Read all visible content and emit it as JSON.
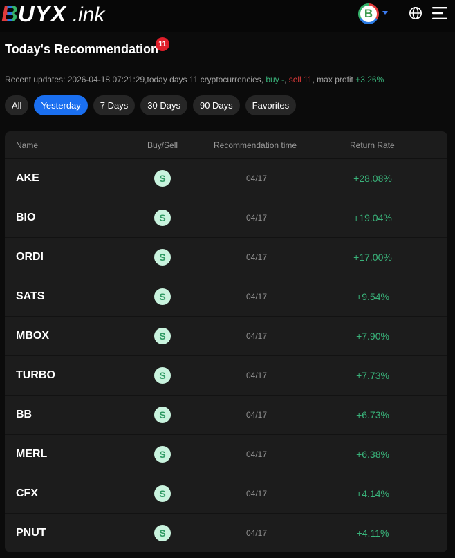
{
  "header": {
    "logo_first_letter": "B",
    "logo_rest": "UYX",
    "logo_tld": ".ink",
    "avatar_letter": "B"
  },
  "page": {
    "title": "Today's Recommendation",
    "badge_count": "11"
  },
  "updates": {
    "prefix": "Recent updates: 2026-04-18 07:21:29,today days 11 cryptocurrencies, ",
    "buy": "buy -",
    "sep1": ", ",
    "sell": "sell 11",
    "sep2": ", max profit ",
    "max_profit": "+3.26%"
  },
  "tabs": [
    {
      "label": "All"
    },
    {
      "label": "Yesterday",
      "active": true
    },
    {
      "label": "7 Days"
    },
    {
      "label": "30 Days"
    },
    {
      "label": "90 Days"
    },
    {
      "label": "Favorites"
    }
  ],
  "table": {
    "headers": [
      "Name",
      "Buy/Sell",
      "Recommendation time",
      "Return Rate"
    ],
    "rows": [
      {
        "name": "AKE",
        "side": "S",
        "time": "04/17",
        "rate": "+28.08%"
      },
      {
        "name": "BIO",
        "side": "S",
        "time": "04/17",
        "rate": "+19.04%"
      },
      {
        "name": "ORDI",
        "side": "S",
        "time": "04/17",
        "rate": "+17.00%"
      },
      {
        "name": "SATS",
        "side": "S",
        "time": "04/17",
        "rate": "+9.54%"
      },
      {
        "name": "MBOX",
        "side": "S",
        "time": "04/17",
        "rate": "+7.90%"
      },
      {
        "name": "TURBO",
        "side": "S",
        "time": "04/17",
        "rate": "+7.73%"
      },
      {
        "name": "BB",
        "side": "S",
        "time": "04/17",
        "rate": "+6.73%"
      },
      {
        "name": "MERL",
        "side": "S",
        "time": "04/17",
        "rate": "+6.38%"
      },
      {
        "name": "CFX",
        "side": "S",
        "time": "04/17",
        "rate": "+4.14%"
      },
      {
        "name": "PNUT",
        "side": "S",
        "time": "04/17",
        "rate": "+4.11%"
      }
    ]
  },
  "colors": {
    "accent": "#1a6ff0",
    "positive": "#39b37a",
    "negative": "#e23a3a",
    "badge": "#e01e2a"
  },
  "icons": [
    "globe-icon",
    "menu-icon",
    "chevron-down-icon"
  ]
}
